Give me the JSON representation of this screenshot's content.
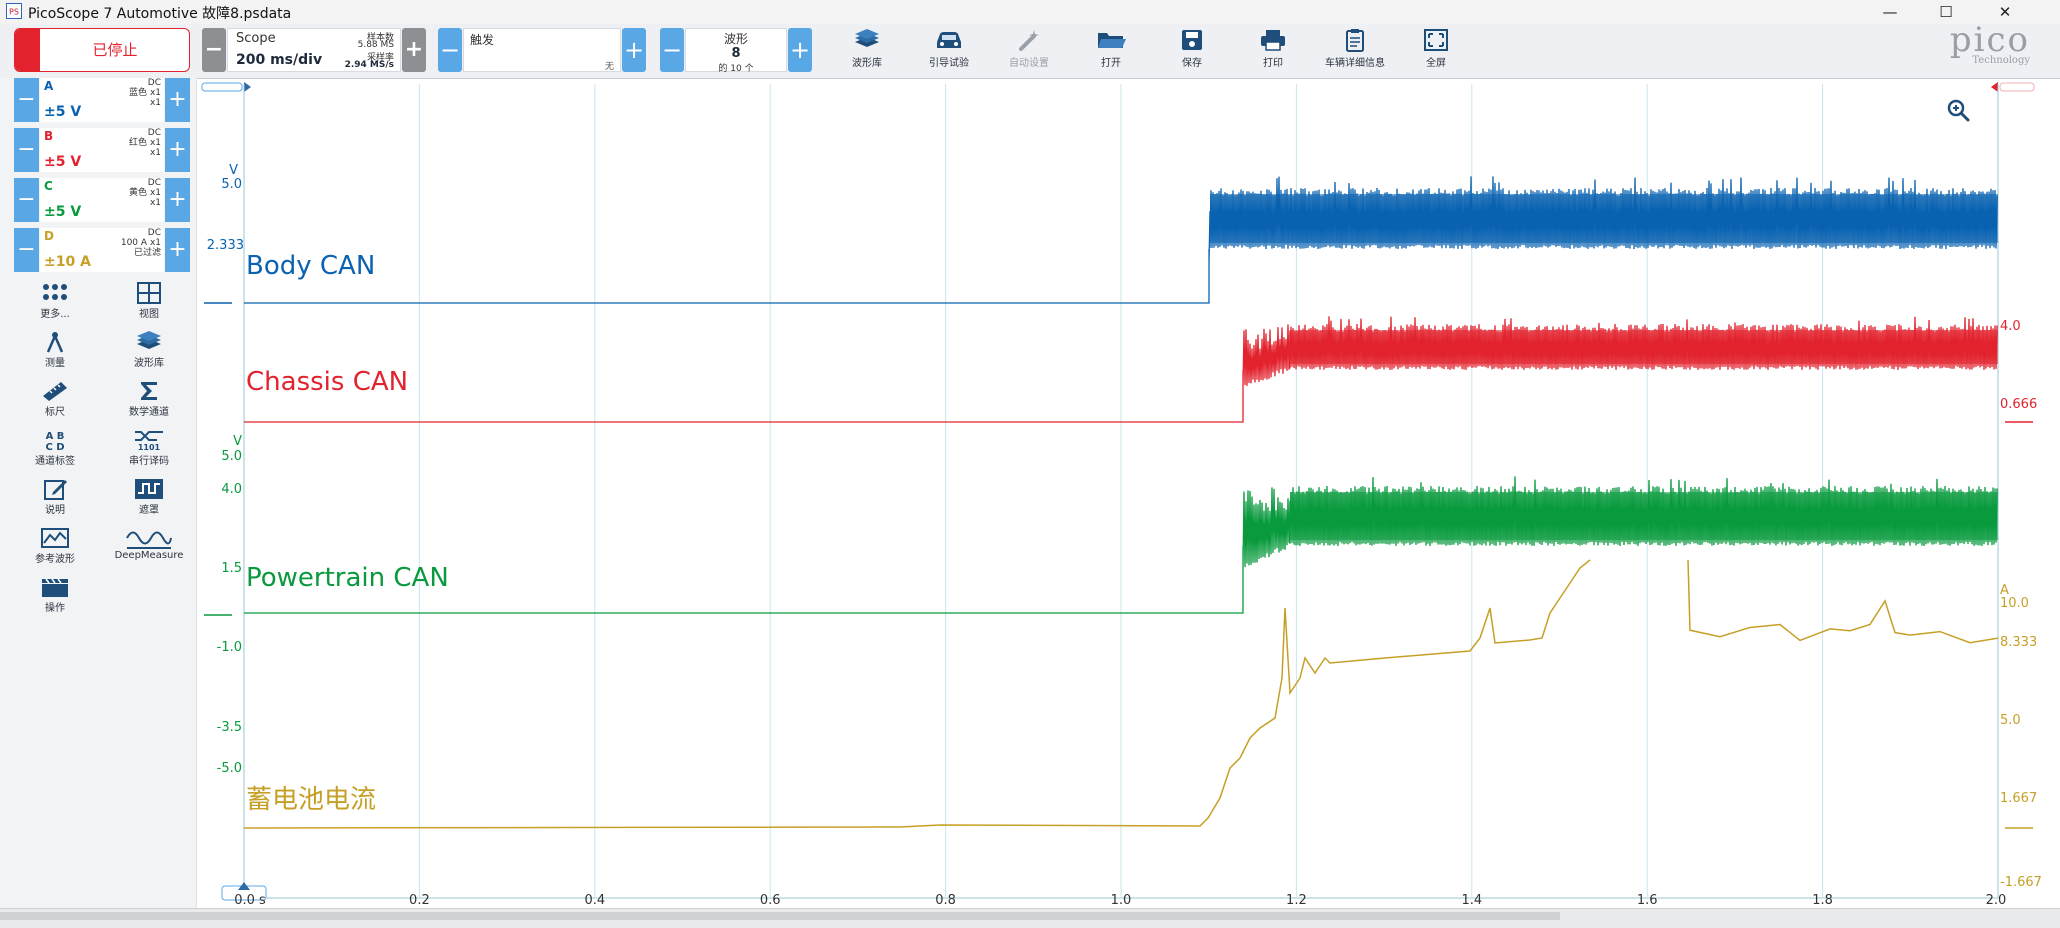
{
  "window": {
    "title": "PicoScope 7 Automotive 故障8.psdata",
    "app_icon_text": "PS",
    "controls": {
      "minimize": "—",
      "maximize": "☐",
      "close": "✕"
    }
  },
  "toolbar": {
    "run_state": "已停止",
    "timebase": {
      "label": "Scope",
      "value": "200 ms/div",
      "samples_label": "样本数",
      "samples": "5.88 MS",
      "rate_label": "采样率",
      "rate": "2.94 MS/s"
    },
    "trigger": {
      "label": "触发",
      "mode": "无"
    },
    "waveform": {
      "label": "波形",
      "number": "8",
      "of": "的 10 个"
    },
    "tools": [
      {
        "name": "waveform-library",
        "label": "波形库",
        "icon": "layers-icon",
        "enabled": true
      },
      {
        "name": "guided-test",
        "label": "引导试验",
        "icon": "car-icon",
        "enabled": true
      },
      {
        "name": "auto-setup",
        "label": "自动设置",
        "icon": "wand-icon",
        "enabled": false
      },
      {
        "name": "open",
        "label": "打开",
        "icon": "folder-icon",
        "enabled": true
      },
      {
        "name": "save",
        "label": "保存",
        "icon": "save-icon",
        "enabled": true
      },
      {
        "name": "print",
        "label": "打印",
        "icon": "printer-icon",
        "enabled": true
      },
      {
        "name": "vehicle-details",
        "label": "车辆详细信息",
        "icon": "clipboard-icon",
        "enabled": true
      },
      {
        "name": "fullscreen",
        "label": "全屏",
        "icon": "fullscreen-icon",
        "enabled": true
      }
    ],
    "logo": {
      "text": "pico",
      "sub": "Technology"
    }
  },
  "channels": [
    {
      "letter": "A",
      "range": "±5 V",
      "coupling": "DC",
      "color_name": "蓝色",
      "probe": "x1",
      "extra": "x1",
      "color": "#0a62b0"
    },
    {
      "letter": "B",
      "range": "±5 V",
      "coupling": "DC",
      "color_name": "红色",
      "probe": "x1",
      "extra": "x1",
      "color": "#e2232e"
    },
    {
      "letter": "C",
      "range": "±5 V",
      "coupling": "DC",
      "color_name": "黄色",
      "probe": "x1",
      "extra": "x1",
      "color": "#099a3e"
    },
    {
      "letter": "D",
      "range": "±10 A",
      "coupling": "DC",
      "color_name": "100 A",
      "probe": "x1",
      "extra": "已过滤",
      "color": "#c6a026"
    }
  ],
  "side_tools": [
    {
      "name": "more",
      "label": "更多...",
      "icon": "dots-grid-icon"
    },
    {
      "name": "view",
      "label": "视图",
      "icon": "view-grid-icon"
    },
    {
      "name": "measure",
      "label": "测量",
      "icon": "compass-icon"
    },
    {
      "name": "waveform-library",
      "label": "波形库",
      "icon": "layers-icon"
    },
    {
      "name": "ruler",
      "label": "标尺",
      "icon": "ruler-icon"
    },
    {
      "name": "math-channels",
      "label": "数学通道",
      "icon": "sigma-icon"
    },
    {
      "name": "channel-labels",
      "label": "通道标签",
      "icon": "abcd-icon"
    },
    {
      "name": "serial-decoding",
      "label": "串行译码",
      "icon": "serial-icon"
    },
    {
      "name": "notes",
      "label": "说明",
      "icon": "note-icon"
    },
    {
      "name": "mask",
      "label": "遮罩",
      "icon": "mask-icon"
    },
    {
      "name": "reference-waveforms",
      "label": "参考波形",
      "icon": "ref-wave-icon"
    },
    {
      "name": "deepmeasure",
      "label": "DeepMeasure",
      "icon": "deepmeasure-icon"
    },
    {
      "name": "actions",
      "label": "操作",
      "icon": "clapper-icon"
    }
  ],
  "plot": {
    "x_axis": {
      "ticks": [
        "0.0 s",
        "0.2",
        "0.4",
        "0.6",
        "0.8",
        "1.0",
        "1.2",
        "1.4",
        "1.6",
        "1.8",
        "2.0"
      ]
    },
    "axis_labels": [
      {
        "id": "a-unit",
        "text": "V"
      },
      {
        "id": "a-top",
        "text": "5.0"
      },
      {
        "id": "a-mid",
        "text": "2.333"
      },
      {
        "id": "b-top",
        "text": "4.0"
      },
      {
        "id": "b-mid",
        "text": "0.666"
      },
      {
        "id": "c-unit",
        "text": "V"
      },
      {
        "id": "c-top",
        "text": "5.0"
      },
      {
        "id": "c-4",
        "text": "4.0"
      },
      {
        "id": "c-15",
        "text": "1.5"
      },
      {
        "id": "c-m1",
        "text": "-1.0"
      },
      {
        "id": "c-m35",
        "text": "-3.5"
      },
      {
        "id": "c-m5",
        "text": "-5.0"
      },
      {
        "id": "d-unit",
        "text": "A"
      },
      {
        "id": "d-10",
        "text": "10.0"
      },
      {
        "id": "d-8",
        "text": "8.333"
      },
      {
        "id": "d-5",
        "text": "5.0"
      },
      {
        "id": "d-1",
        "text": "1.667"
      },
      {
        "id": "d-m1",
        "text": "-1.667"
      }
    ],
    "trace_labels": [
      {
        "text": "Body CAN",
        "color": "#0a62b0"
      },
      {
        "text": "Chassis CAN",
        "color": "#e2232e"
      },
      {
        "text": "Powertrain CAN",
        "color": "#099a3e"
      },
      {
        "text": "蓄电池电流",
        "color": "#c6a026"
      }
    ],
    "grid": true,
    "zoom_icon": "zoom-in-icon"
  }
}
